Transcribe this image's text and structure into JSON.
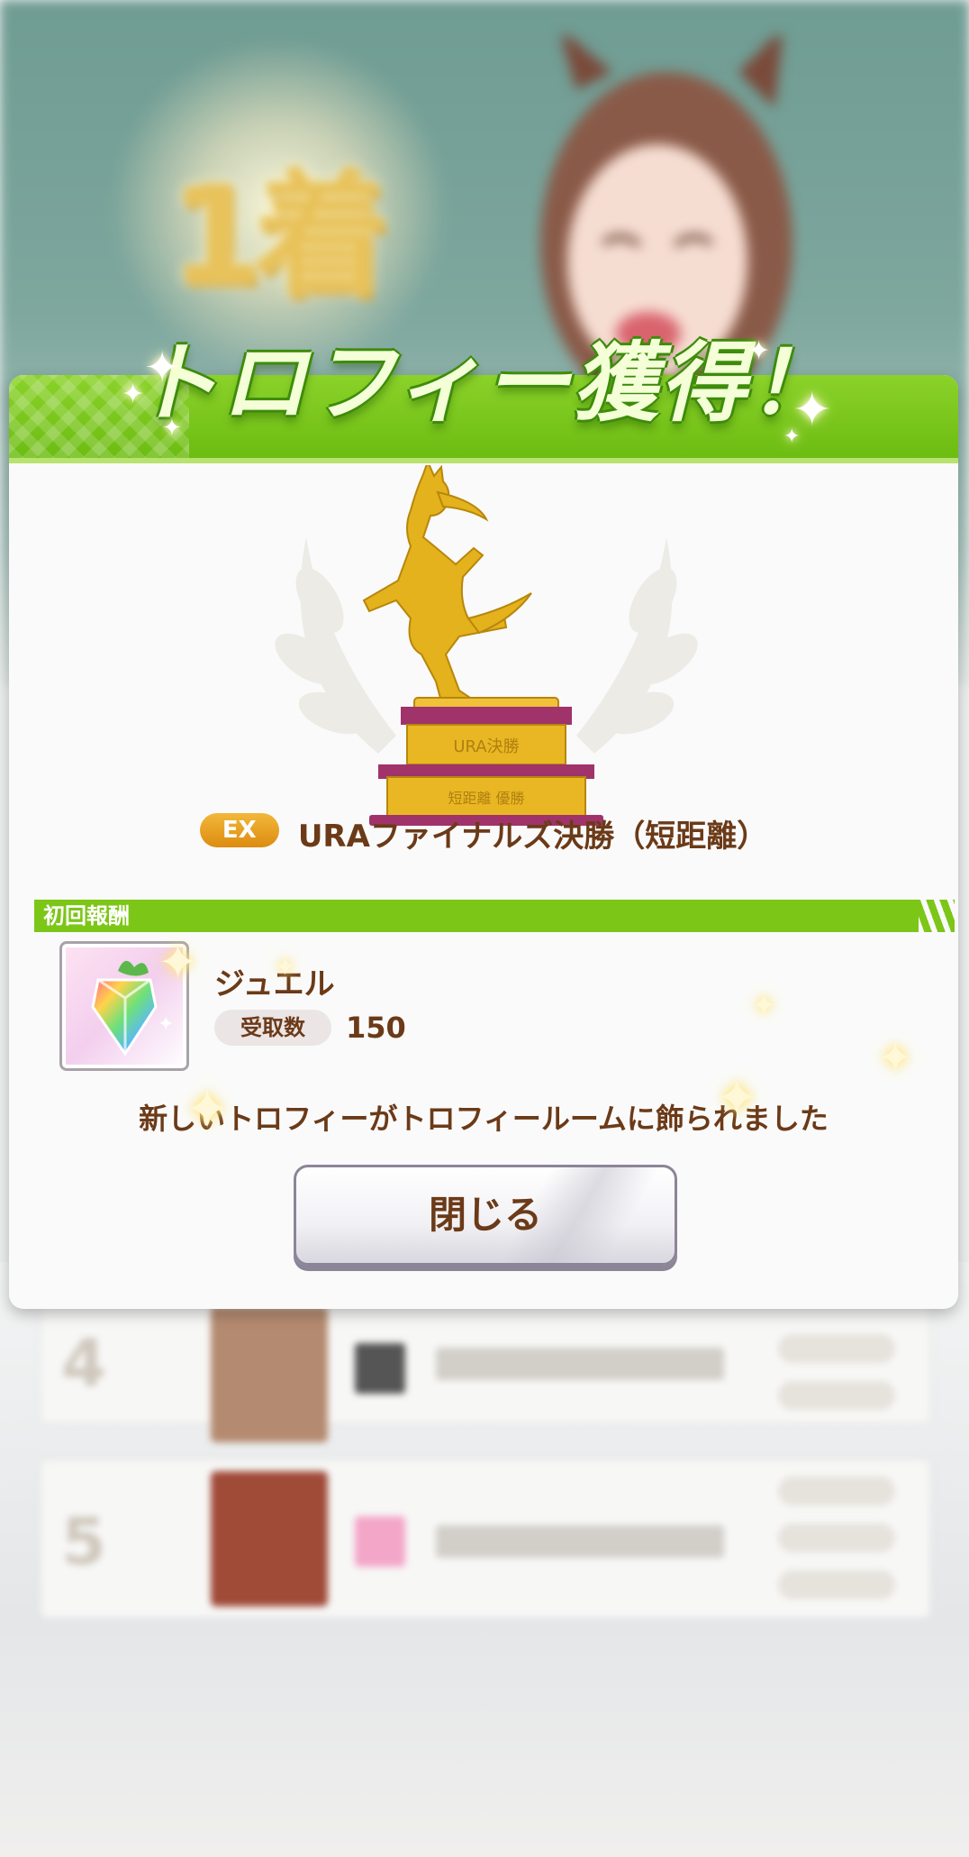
{
  "dialog": {
    "title": "トロフィー獲得！",
    "trophy": {
      "badge": "EX",
      "name": "URAファイナルズ決勝（短距離）",
      "plate_top": "URA決勝",
      "plate_bottom": "短距離 優勝"
    },
    "reward": {
      "section_label": "初回報酬",
      "item_name": "ジュエル",
      "quantity_label": "受取数",
      "quantity": "150"
    },
    "notice": "新しいトロフィーがトロフィールームに飾られました",
    "close_button": "閉じる"
  },
  "colors": {
    "header_green": "#7cc618",
    "text_brown": "#6b3a18",
    "trophy_gold": "#e3b21c",
    "trophy_base": "#a0336a"
  },
  "icons": [
    "sparkle-icon",
    "trophy-icon",
    "jewel-icon"
  ]
}
